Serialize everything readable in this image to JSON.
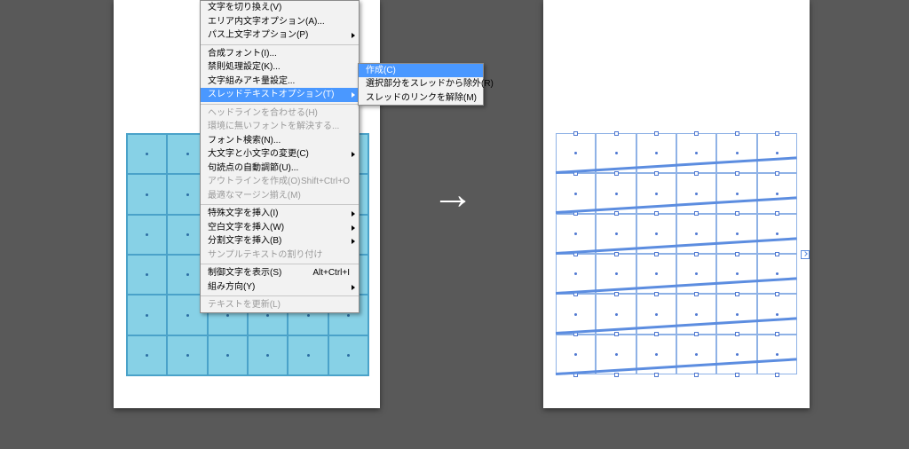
{
  "menu_main": {
    "groups": [
      [
        {
          "label": "文字を切り換え(V)",
          "enabled": true
        },
        {
          "label": "エリア内文字オプション(A)...",
          "enabled": true
        },
        {
          "label": "パス上文字オプション(P)",
          "enabled": true,
          "arrow": true
        }
      ],
      [
        {
          "label": "合成フォント(I)...",
          "enabled": true
        },
        {
          "label": "禁則処理設定(K)...",
          "enabled": true
        },
        {
          "label": "文字組みアキ量設定...",
          "enabled": true
        },
        {
          "label": "スレッドテキストオプション(T)",
          "enabled": true,
          "arrow": true,
          "highlight": true
        }
      ],
      [
        {
          "label": "ヘッドラインを合わせる(H)",
          "enabled": false
        },
        {
          "label": "環境に無いフォントを解決する...",
          "enabled": false
        },
        {
          "label": "フォント検索(N)...",
          "enabled": true
        },
        {
          "label": "大文字と小文字の変更(C)",
          "enabled": true,
          "arrow": true
        },
        {
          "label": "句読点の自動調節(U)...",
          "enabled": true
        },
        {
          "label": "アウトラインを作成(O)",
          "enabled": false,
          "shortcut": "Shift+Ctrl+O"
        },
        {
          "label": "最適なマージン揃え(M)",
          "enabled": false
        }
      ],
      [
        {
          "label": "特殊文字を挿入(I)",
          "enabled": true,
          "arrow": true
        },
        {
          "label": "空白文字を挿入(W)",
          "enabled": true,
          "arrow": true
        },
        {
          "label": "分割文字を挿入(B)",
          "enabled": true,
          "arrow": true
        },
        {
          "label": "サンプルテキストの割り付け",
          "enabled": false
        }
      ],
      [
        {
          "label": "制御文字を表示(S)",
          "enabled": true,
          "shortcut": "Alt+Ctrl+I"
        },
        {
          "label": "組み方向(Y)",
          "enabled": true,
          "arrow": true
        }
      ],
      [
        {
          "label": "テキストを更新(L)",
          "enabled": false
        }
      ]
    ]
  },
  "menu_sub": {
    "items": [
      {
        "label": "作成(C)",
        "highlight": true
      },
      {
        "label": "選択部分をスレッドから除外(R)"
      },
      {
        "label": "スレッドのリンクを解除(M)"
      }
    ]
  },
  "arrow_glyph": "→",
  "grid": {
    "rows": 6,
    "cols": 6
  }
}
